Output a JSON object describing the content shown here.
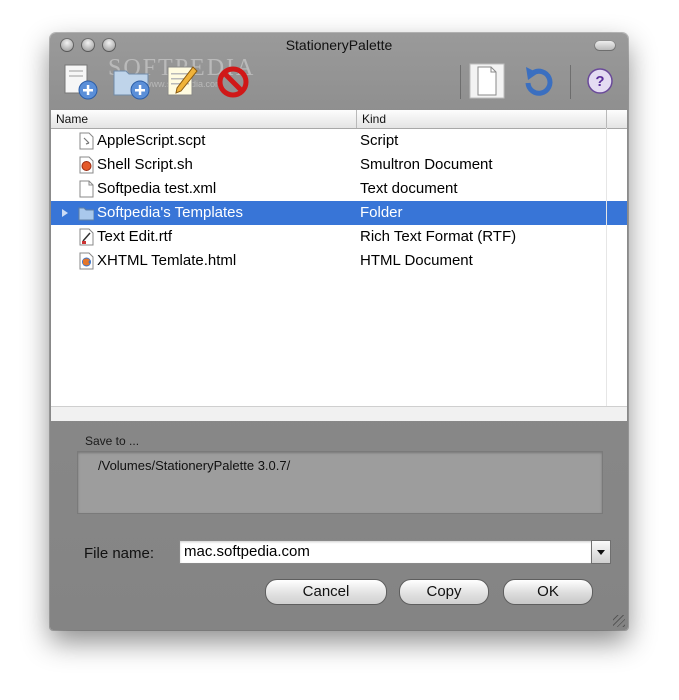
{
  "window": {
    "title": "StationeryPalette"
  },
  "watermark": {
    "brand": "SOFTPEDIA",
    "url": "www.softpedia.com"
  },
  "toolbar": {
    "buttons": [
      {
        "name": "new-stationery-button",
        "icon": "new-file-plus-icon"
      },
      {
        "name": "new-folder-button",
        "icon": "new-folder-plus-icon"
      },
      {
        "name": "edit-button",
        "icon": "pencil-notepad-icon"
      },
      {
        "name": "remove-button",
        "icon": "prohibited-icon"
      },
      {
        "name": "preview-button",
        "icon": "document-icon"
      },
      {
        "name": "refresh-button",
        "icon": "refresh-icon"
      },
      {
        "name": "help-button",
        "icon": "help-icon"
      }
    ]
  },
  "list": {
    "columns": {
      "name": "Name",
      "kind": "Kind"
    },
    "rows": [
      {
        "name": "AppleScript.scpt",
        "kind": "Script",
        "icon": "applescript-file-icon",
        "selected": false
      },
      {
        "name": "Shell Script.sh",
        "kind": "Smultron Document",
        "icon": "shell-script-file-icon",
        "selected": false
      },
      {
        "name": "Softpedia test.xml",
        "kind": "Text document",
        "icon": "text-file-icon",
        "selected": false
      },
      {
        "name": "Softpedia's Templates",
        "kind": "Folder",
        "icon": "folder-icon",
        "selected": true
      },
      {
        "name": "Text Edit.rtf",
        "kind": "Rich Text Format (RTF)",
        "icon": "rtf-file-icon",
        "selected": false
      },
      {
        "name": "XHTML Temlate.html",
        "kind": "HTML Document",
        "icon": "html-file-icon",
        "selected": false
      }
    ]
  },
  "save": {
    "label": "Save to ...",
    "path": "/Volumes/StationeryPalette 3.0.7/"
  },
  "filename": {
    "label": "File name:",
    "value": "mac.softpedia.com"
  },
  "buttons": {
    "cancel": "Cancel",
    "copy": "Copy",
    "ok": "OK"
  },
  "colors": {
    "selection": "#3875d7",
    "window": "#8c8c8c"
  }
}
